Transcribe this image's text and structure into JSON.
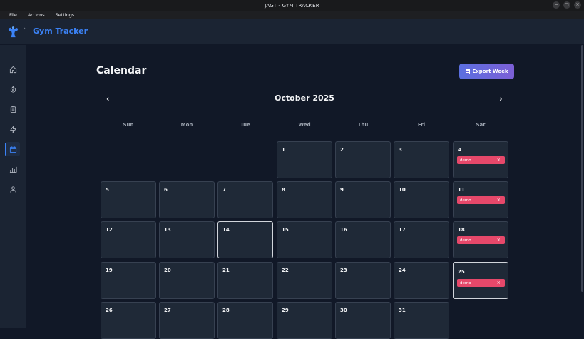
{
  "window": {
    "title": "JAGT - GYM TRACKER",
    "controls": [
      "−",
      "□",
      "×"
    ]
  },
  "menubar": [
    "File",
    "Actions",
    "Settings"
  ],
  "header": {
    "app_title": "Gym Tracker",
    "collapse": "›"
  },
  "sidebar": {
    "items": [
      {
        "name": "home",
        "icon": "home-icon"
      },
      {
        "name": "exercises",
        "icon": "dumbbell-icon"
      },
      {
        "name": "workouts",
        "icon": "clipboard-icon"
      },
      {
        "name": "activity",
        "icon": "lightning-icon"
      },
      {
        "name": "calendar",
        "icon": "calendar-icon",
        "active": true
      },
      {
        "name": "stats",
        "icon": "bar-chart-icon"
      },
      {
        "name": "profile",
        "icon": "user-icon"
      }
    ]
  },
  "page": {
    "title": "Calendar",
    "export_label": "Export Week"
  },
  "calendar": {
    "month_label": "October 2025",
    "prev": "‹",
    "next": "›",
    "weekdays": [
      "Sun",
      "Mon",
      "Tue",
      "Wed",
      "Thu",
      "Fri",
      "Sat"
    ],
    "weeks": [
      [
        null,
        null,
        null,
        {
          "day": "1"
        },
        {
          "day": "2"
        },
        {
          "day": "3"
        },
        {
          "day": "4",
          "tag": "demo"
        }
      ],
      [
        {
          "day": "5"
        },
        {
          "day": "6"
        },
        {
          "day": "7"
        },
        {
          "day": "8"
        },
        {
          "day": "9"
        },
        {
          "day": "10"
        },
        {
          "day": "11",
          "tag": "demo"
        }
      ],
      [
        {
          "day": "12"
        },
        {
          "day": "13"
        },
        {
          "day": "14",
          "highlight": "today"
        },
        {
          "day": "15"
        },
        {
          "day": "16"
        },
        {
          "day": "17"
        },
        {
          "day": "18",
          "tag": "demo"
        }
      ],
      [
        {
          "day": "19"
        },
        {
          "day": "20"
        },
        {
          "day": "21"
        },
        {
          "day": "22"
        },
        {
          "day": "23"
        },
        {
          "day": "24"
        },
        {
          "day": "25",
          "tag": "demo",
          "highlight": "selected"
        }
      ],
      [
        {
          "day": "26"
        },
        {
          "day": "27"
        },
        {
          "day": "28"
        },
        {
          "day": "29"
        },
        {
          "day": "30"
        },
        {
          "day": "31"
        },
        null
      ]
    ],
    "tag_remove": "×"
  },
  "colors": {
    "accent": "#3b82f6",
    "tag": "#e6486a",
    "background": "#111827",
    "cell": "#1f2937"
  }
}
